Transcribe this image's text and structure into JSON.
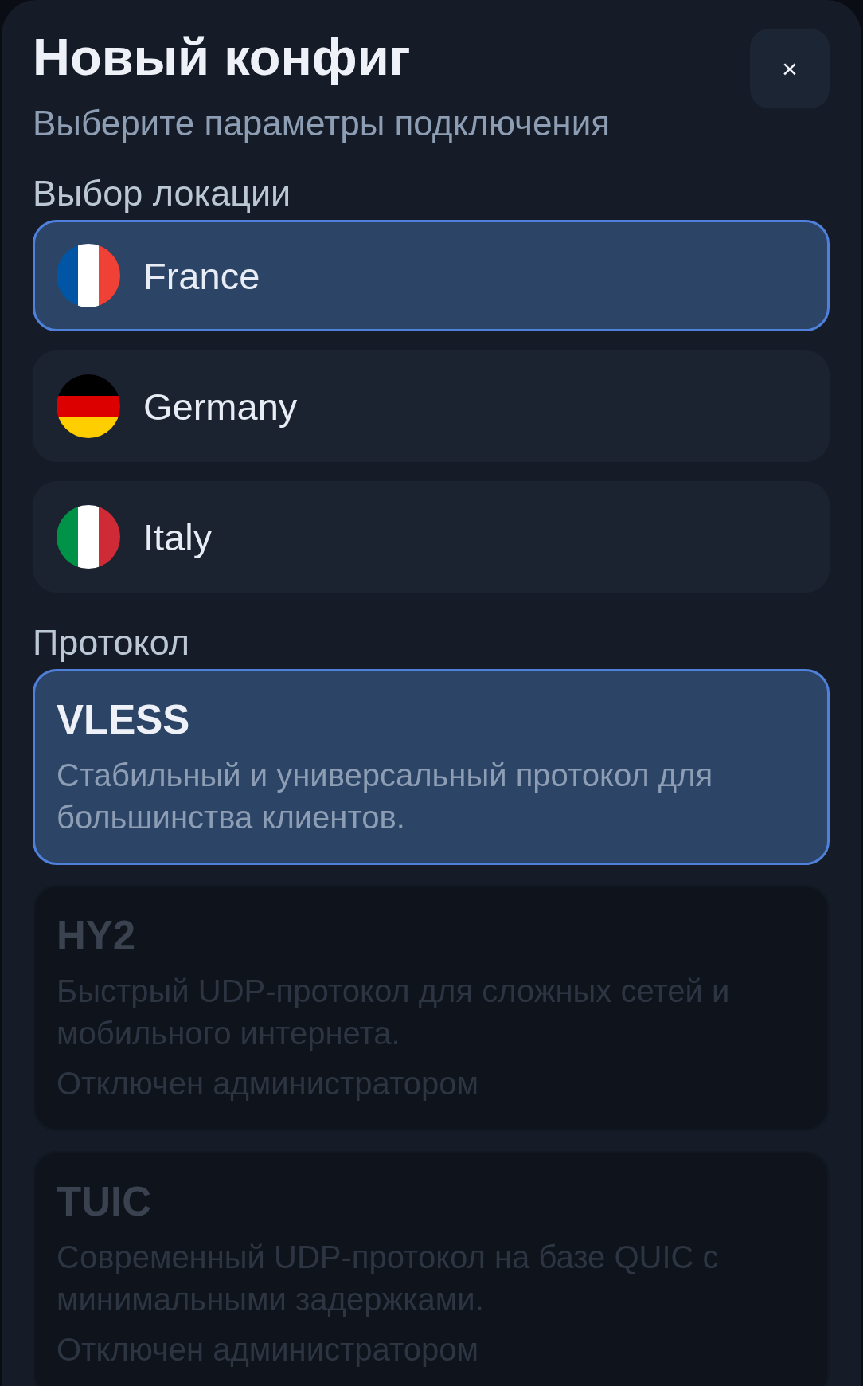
{
  "sheet": {
    "title": "Новый конфиг",
    "subtitle": "Выберите параметры подключения",
    "close_button": {
      "label": "×"
    }
  },
  "location": {
    "heading": "Выбор локации",
    "options": [
      {
        "name": "France",
        "selected": true,
        "kind": "france"
      },
      {
        "name": "Germany",
        "selected": false,
        "kind": "germany"
      },
      {
        "name": "Italy",
        "selected": false,
        "kind": "italy"
      }
    ]
  },
  "protocol": {
    "heading": "Протокол",
    "options": [
      {
        "name": "VLESS",
        "description": "Стабильный и универсальный протокол для большинства клиентов.",
        "selected": true,
        "disabled": false
      },
      {
        "name": "HY2",
        "description": "Быстрый UDP-протокол для сложных сетей и мобильного интернета.",
        "selected": false,
        "disabled": true,
        "note": "Отключен администратором"
      },
      {
        "name": "TUIC",
        "description": "Современный UDP-протокол на базе QUIC с минимальными задержками.",
        "selected": false,
        "disabled": true,
        "note": "Отключен администратором"
      }
    ]
  }
}
